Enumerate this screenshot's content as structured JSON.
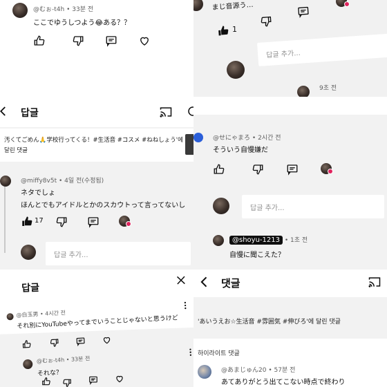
{
  "panels": {
    "top_left": {
      "comment": {
        "author": "@むぉ-t4h",
        "time": "33분 전",
        "text": "ここでゆうしつよう😂ある？？"
      }
    },
    "top_right": {
      "comment_text": "まじ音源う…",
      "likes": "1",
      "reply_placeholder": "답글 추가...",
      "time": "9초 전"
    },
    "middle_left": {
      "title": "답글",
      "quote": "汚くてごめん🙏学校行ってくる！#生活音 #コスメ #ねねしょう'에 달린 댓글",
      "reply": {
        "author": "@miffy8v5t",
        "time": "4일 전(수정됨)",
        "line1": "ネタでしょ",
        "line2": "ほんとでもアイドルとかのスカウトって言ってないし"
      },
      "likes": "17",
      "reply_placeholder": "답글 추가..."
    },
    "middle_right": {
      "comment": {
        "author": "@せにゃまろ",
        "time": "2시간 전",
        "text": "そういう自慢嫌だ"
      },
      "reply_placeholder": "답글 추가...",
      "reply": {
        "author": "@shoyu-1213",
        "time": "1초 전",
        "text": "自慢に聞こえた？"
      }
    },
    "bottom_left": {
      "title": "답글",
      "comment": {
        "author": "@白玉男",
        "time": "4시간 전",
        "text": "それ別にYouTubeやってまでいうことじゃないと思うけど"
      },
      "reply": {
        "author": "@むぉ-t4h",
        "time": "33분 전",
        "text": "それな？"
      }
    },
    "bottom_right": {
      "title": "댓글",
      "quote": "'あいうえお☆生活音 #雰囲気 #伸びろ'에 달린 댓글",
      "section_label": "하이라이트 댓글",
      "comment": {
        "author": "@あまじゅん20",
        "time": "57분 전",
        "text": "あてありがとう出てこない時点で終わり"
      }
    }
  },
  "icons": [
    "like-icon",
    "dislike-icon",
    "reply-icon",
    "heart-icon",
    "back-icon",
    "cast-icon",
    "close-icon",
    "more-icon"
  ],
  "colors": {
    "heart": "#e0245e",
    "muted": "#606060",
    "panel_gray": "#f2f2f2"
  }
}
